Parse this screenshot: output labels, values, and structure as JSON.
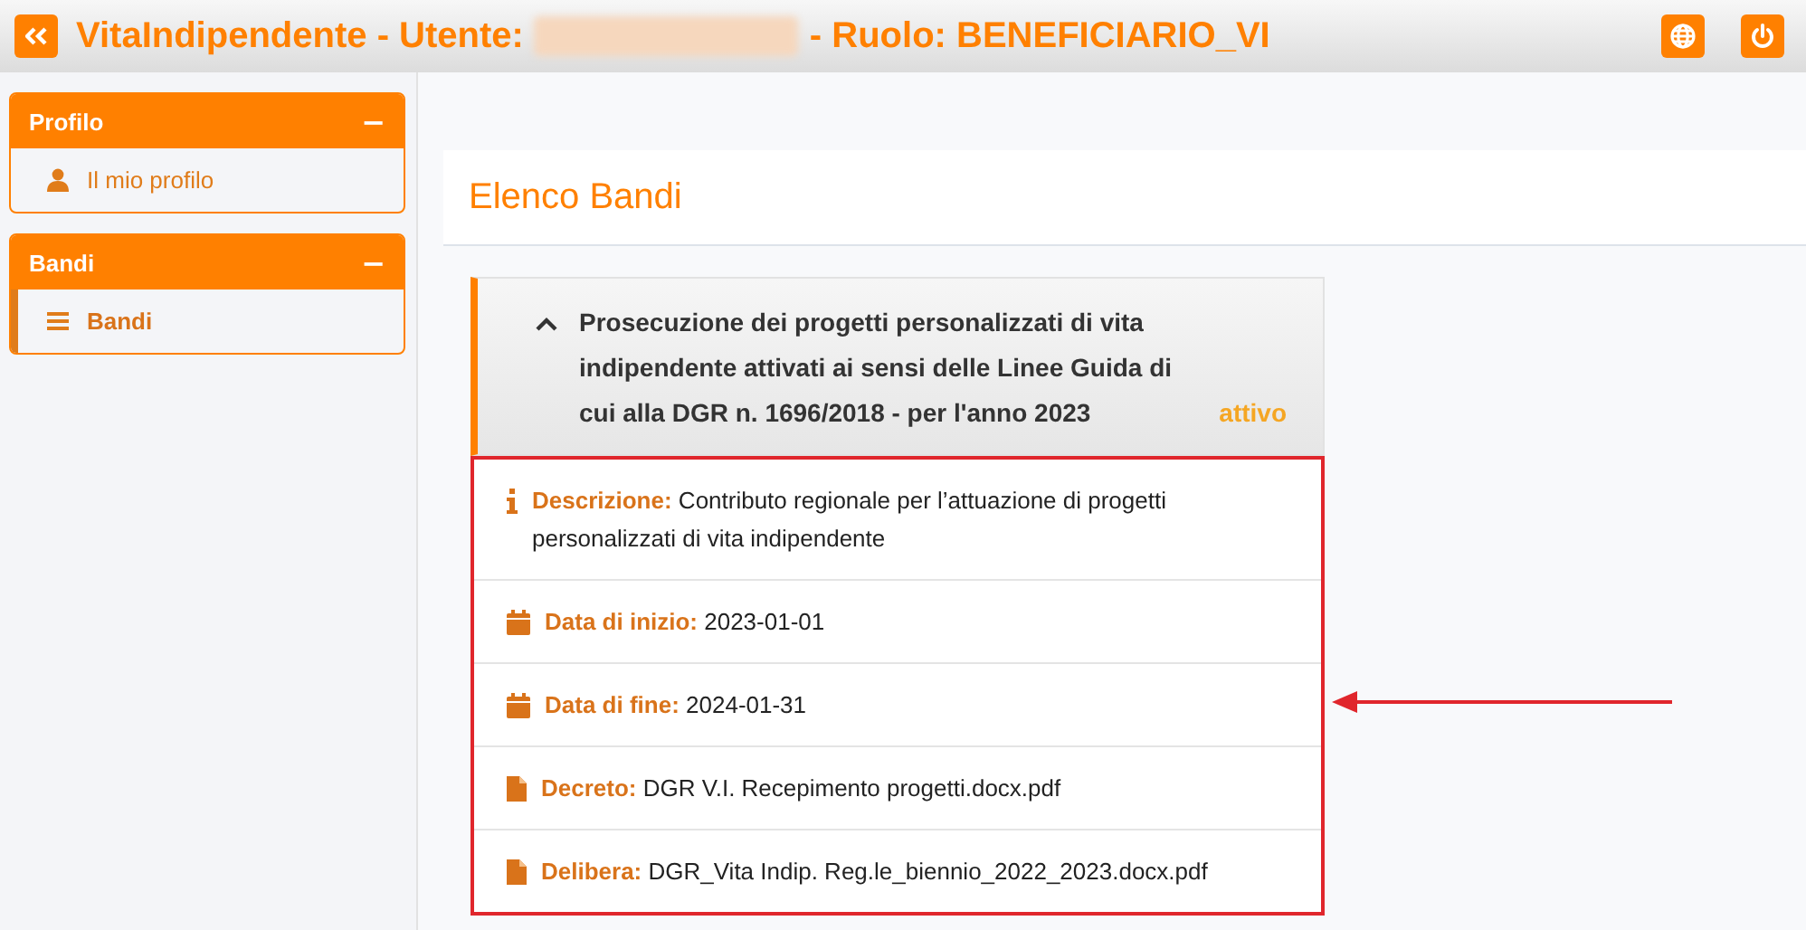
{
  "header": {
    "app_name": "VitaIndipendente - Utente:",
    "user_blurred": true,
    "role": "- Ruolo: BENEFICIARIO_VI"
  },
  "sidebar": {
    "panels": [
      {
        "title": "Profilo",
        "collapse_label": "−",
        "items": [
          {
            "label": "Il mio profilo",
            "kind": "user",
            "selected": false
          }
        ]
      },
      {
        "title": "Bandi",
        "collapse_label": "−",
        "items": [
          {
            "label": "Bandi",
            "kind": "list",
            "selected": true
          }
        ]
      }
    ]
  },
  "page_title": "Elenco Bandi",
  "bando": {
    "expanded": true,
    "title": "Prosecuzione dei progetti personalizzati di vita indipendente attivati ai sensi delle Linee Guida di cui alla DGR n. 1696/2018 - per l'anno 2023",
    "status": "attivo",
    "details": [
      {
        "kind": "info",
        "label": "Descrizione:",
        "value": "Contributo regionale per l’attuazione di progetti personalizzati di vita indipendente"
      },
      {
        "kind": "calendar",
        "label": "Data di inizio:",
        "value": "2023-01-01"
      },
      {
        "kind": "calendar",
        "label": "Data di fine:",
        "value": "2024-01-31"
      },
      {
        "kind": "file",
        "label": "Decreto:",
        "value": "DGR V.I. Recepimento progetti.docx.pdf"
      },
      {
        "kind": "file",
        "label": "Delibera:",
        "value": "DGR_Vita Indip. Reg.le_biennio_2022_2023.docx.pdf"
      }
    ]
  },
  "annotations": {
    "highlight_box": true,
    "arrow": true
  }
}
